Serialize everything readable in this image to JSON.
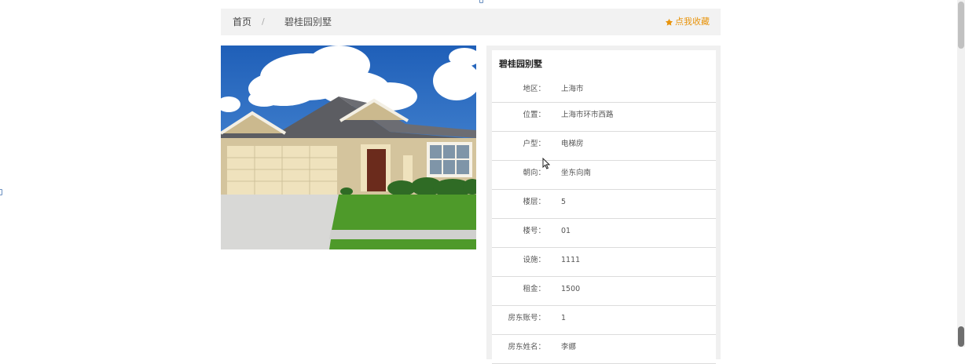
{
  "breadcrumb": {
    "home": "首页",
    "separator": "/",
    "current": "碧桂园别墅"
  },
  "favorite": {
    "label": "点我收藏",
    "icon": "star-icon",
    "color": "#e8940c"
  },
  "photo": {
    "icon": "house-photo"
  },
  "info": {
    "title": "碧桂园别墅",
    "rows": [
      {
        "label": "地区：",
        "value": "上海市"
      },
      {
        "label": "位置：",
        "value": "上海市环市西路"
      },
      {
        "label": "户型：",
        "value": "电梯房"
      },
      {
        "label": "朝向：",
        "value": "坐东向南"
      },
      {
        "label": "楼层：",
        "value": "5"
      },
      {
        "label": "楼号：",
        "value": "01"
      },
      {
        "label": "设施：",
        "value": "1111"
      },
      {
        "label": "租金：",
        "value": "1500"
      },
      {
        "label": "房东账号：",
        "value": "1"
      },
      {
        "label": "房东姓名：",
        "value": "李娜"
      }
    ]
  }
}
